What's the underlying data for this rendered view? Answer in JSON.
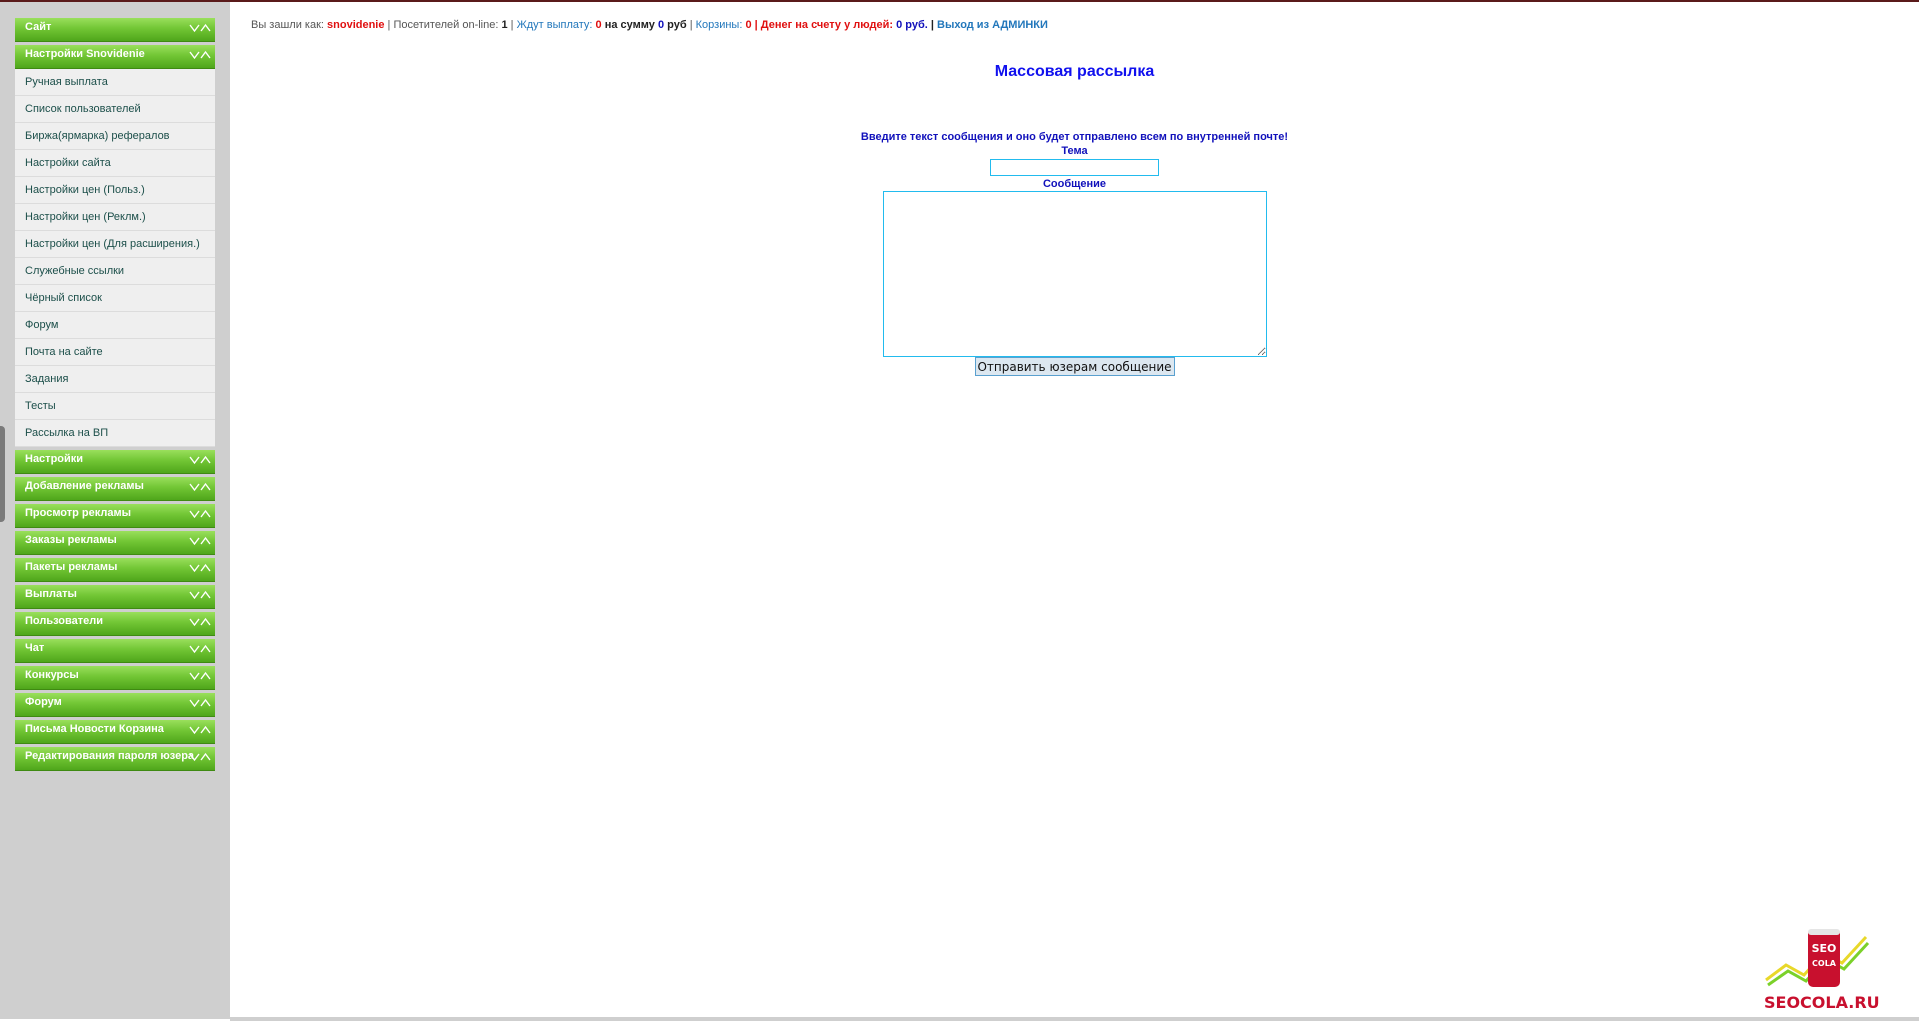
{
  "sidebar": {
    "groups_top": [
      {
        "label": "Сайт",
        "icon": "expand-collapse-arrows-icon"
      },
      {
        "label": "Настройки Snovidenie",
        "icon": "expand-collapse-arrows-icon"
      }
    ],
    "submenu": [
      "Ручная выплата",
      "Список пользователей",
      "Биржа(ярмарка) рефералов",
      "Настройки сайта",
      "Настройки цен (Польз.)",
      "Настройки цен (Реклм.)",
      "Настройки цен (Для расширения.)",
      "Служебные ссылки",
      "Чёрный список",
      "Форум",
      "Почта на сайте",
      "Задания",
      "Тесты",
      "Рассылка на ВП"
    ],
    "groups_bottom": [
      {
        "label": "Настройки"
      },
      {
        "label": "Добавление рекламы"
      },
      {
        "label": "Просмотр рекламы"
      },
      {
        "label": "Заказы рекламы"
      },
      {
        "label": "Пакеты рекламы"
      },
      {
        "label": "Выплаты"
      },
      {
        "label": "Пользователи"
      },
      {
        "label": "Чат"
      },
      {
        "label": "Конкурсы"
      },
      {
        "label": "Форум"
      },
      {
        "label": "Письма Новости Корзина"
      },
      {
        "label": "Редактирования пароля юзера"
      }
    ]
  },
  "topbar": {
    "logged_in_as_label": "Вы зашли как:",
    "username": "snovidenie",
    "sep1": "|",
    "visitors_label": "Посетителей on-line:",
    "visitors_count": "1",
    "sep2": "|",
    "awaiting_payout_label": "Ждут выплату:",
    "awaiting_payout_count": "0",
    "sum_label": "на сумму",
    "sum_value": "0",
    "currency_rub": "руб",
    "sep3": "|",
    "carts_label": "Корзины:",
    "carts_count": "0",
    "money_label": "| Денег на счету у людей:",
    "money_value": "0 руб.",
    "sep4": "|",
    "logout_label": "Выход из АДМИНКИ"
  },
  "main": {
    "title": "Массовая рассылка",
    "instructions": "Введите текст сообщения и оно будет отправлено всем по внутренней почте!",
    "subject_label": "Тема",
    "subject_value": "",
    "message_label": "Сообщение",
    "message_value": "",
    "send_button_label": "Отправить юзерам сообщение"
  },
  "logo": {
    "text": "SEOCOLA.RU",
    "can_text_top": "SEO",
    "can_text_bottom": "COLA",
    "colors": {
      "red": "#c8102e",
      "green": "#7bd12a",
      "yellow": "#e8d82a"
    }
  },
  "colors": {
    "accent_green": "#5cb82a",
    "link_blue": "#2277bb",
    "title_blue": "#1111ee",
    "alert_red": "#e01010",
    "input_border": "#22bbee"
  }
}
